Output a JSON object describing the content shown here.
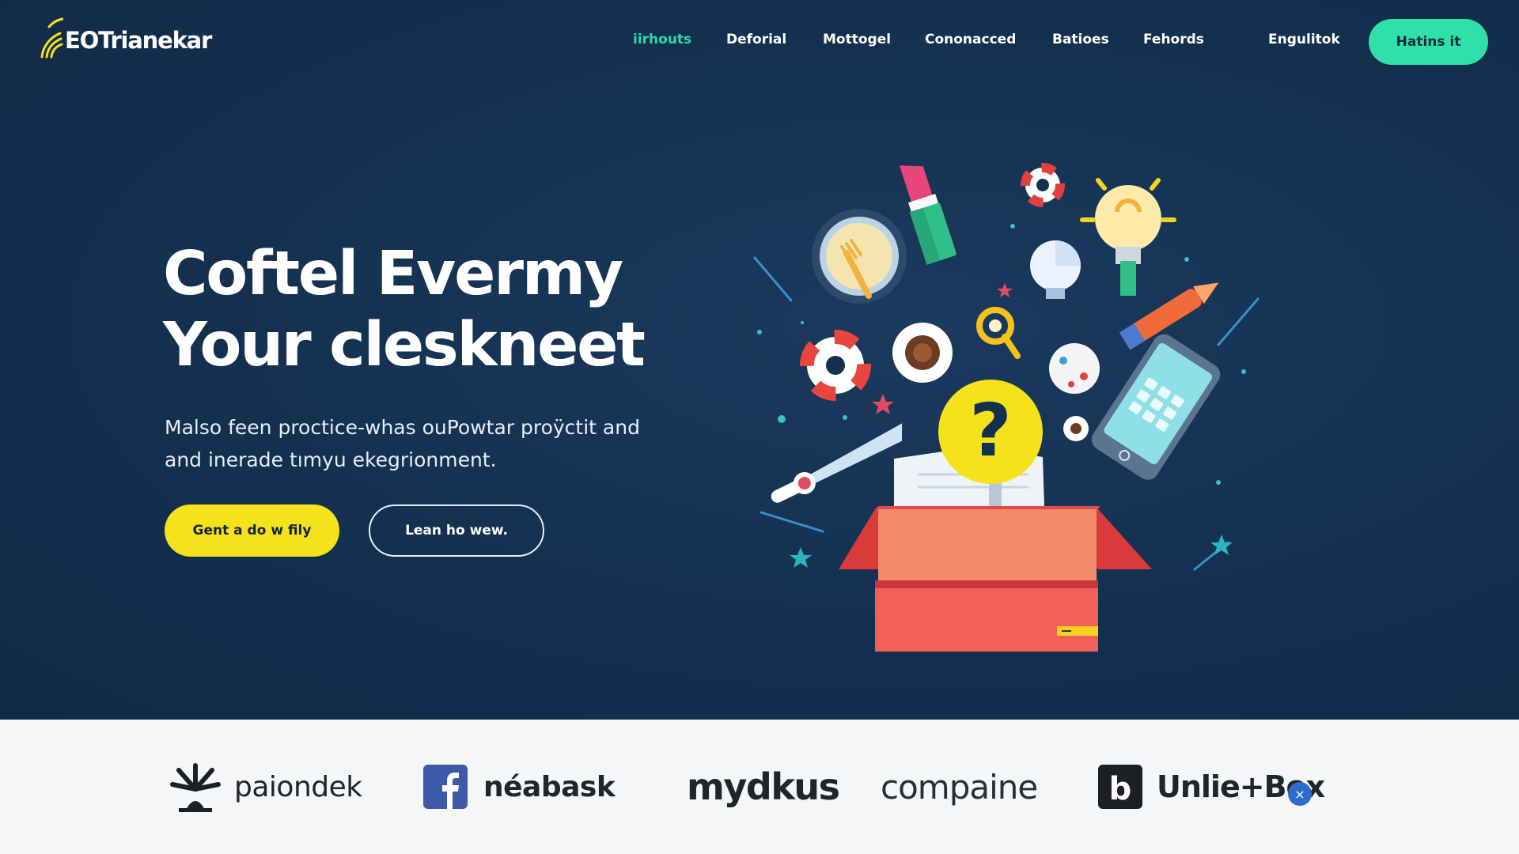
{
  "brand": {
    "name": "EOTrianekar",
    "logo_icon": "signal-arcs-icon",
    "accent": "#2fe0a9"
  },
  "nav": {
    "items": [
      {
        "label": "iirhouts",
        "active": true
      },
      {
        "label": "Deforial",
        "active": false
      },
      {
        "label": "Mottogel",
        "active": false
      },
      {
        "label": "Cononacced",
        "active": false
      },
      {
        "label": "Batioes",
        "active": false
      },
      {
        "label": "Fehords",
        "active": false
      }
    ],
    "language_label": "Engulitok",
    "cta_label": "Hatins it"
  },
  "hero": {
    "headline_line1": "Coftel Evermy",
    "headline_line2": "Your cleskneet",
    "subtext_line1": "Malso feen proctice-whas ouPowtar proÿctit and",
    "subtext_line2": "and inerade tımyu ekegrionment.",
    "primary_button": "Gent a do w fily",
    "secondary_button": "Lean ho wew.",
    "colors": {
      "background": "#13304f",
      "primary_button": "#f6e21a",
      "question_badge": "#f6e21a"
    },
    "illustration_icons": [
      "gift-box-icon",
      "question-mark-icon",
      "phone-icon",
      "light-bulb-icon",
      "lipstick-icon",
      "pen-icon",
      "life-buoy-icon",
      "coffee-cup-icon",
      "magnifier-icon",
      "plate-icon"
    ]
  },
  "partners": [
    {
      "name": "paiondek",
      "icon": "tree-logo-icon"
    },
    {
      "name": "néabask",
      "icon": "facebook-icon"
    },
    {
      "name": "mydkus",
      "icon": ""
    },
    {
      "name": "compaine",
      "icon": ""
    },
    {
      "name": "Unlie+Box",
      "icon": "b-logo-icon"
    }
  ],
  "close_badge": "×"
}
